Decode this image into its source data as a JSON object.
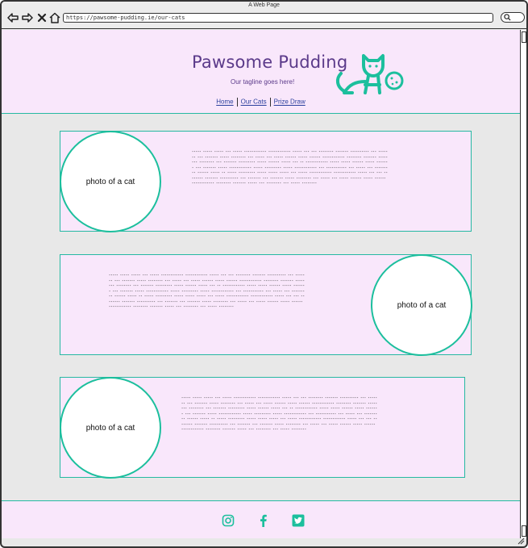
{
  "window": {
    "title": "A Web Page"
  },
  "browser": {
    "url": "https://pawsome-pudding.ie/our-cats"
  },
  "header": {
    "title": "Pawsome Pudding",
    "tagline": "Our tagline goes here!",
    "nav": [
      {
        "label": "Home"
      },
      {
        "label": "Our Cats"
      },
      {
        "label": "Prize Draw"
      }
    ]
  },
  "cards": [
    {
      "photo_label": "photo of a cat",
      "text": "----- ----- ----- --- ----- ------------ ------------ ----- --- --- -------- ------- ---------- --- ------- --- ------- ----- -------- --- ----- --- ----- ------ ----- ------ ------------ -------- ------- ----- --- -------- --- ------- --------- ----- ------ ----- --- -- ------------ ----- ----- ------ ----- ------- --- ------- ----- ------------ ----- --------- ----- ------------ --- ----------- --- ----- --- --------- ------ ----- -- ----- --------- ----- ----- ----- --- ----- ------------ ------------ ----- --- --- -------- ------- ---------- --- ------- --- ------- ----- -------- --- ----- --- ----- ------ ----- ------ ------------ -------- ------- ----- --- -------- --- ----- --------"
    },
    {
      "photo_label": "photo of a cat",
      "text": "----- ----- ----- --- ----- ------------ ------------ ----- --- --- -------- ------- ---------- --- ------- --- ------- ----- -------- --- ----- --- ----- ------ ----- ------ ------------ -------- ------- ----- --- -------- --- ------- --------- ----- ------ ----- --- -- ------------ ----- ----- ------ ----- ------- --- ------- ----- ------------ ----- --------- ----- ------------ --- ----------- --- ----- --- --------- ------ ----- -- ----- --------- ----- ----- ----- --- ----- ------------ ------------ ----- --- --- -------- ------- ---------- --- ------- --- ------- ----- -------- --- ----- --- ----- ------ ----- ------ ------------ -------- ------- ----- --- -------- --- ----- --------"
    },
    {
      "photo_label": "photo of a cat",
      "text": "----- ----- ----- --- ----- ------------ ------------ ----- --- --- -------- ------- ---------- --- ------- --- ------- ----- -------- --- ----- --- ----- ------ ----- ------ ------------ -------- ------- ----- --- -------- --- ------- --------- ----- ------ ----- --- -- ------------ ----- ----- ------ ----- ------- --- ------- ----- ------------ ----- --------- ----- ------------ --- ----------- --- ----- --- --------- ------ ----- -- ----- --------- ----- ----- ----- --- ----- ------------ ------------ ----- --- --- -------- ------- ---------- --- ------- --- ------- ----- -------- --- ----- --- ----- ------ ----- ------ ------------ -------- ------- ----- --- -------- --- ----- --------"
    }
  ],
  "footer": {
    "icons": [
      "instagram-icon",
      "facebook-icon",
      "twitter-icon"
    ]
  },
  "colors": {
    "accent": "#1cbf9d",
    "title": "#5b3a8a",
    "panel": "#f9e7fb",
    "link": "#2a3f9e"
  }
}
